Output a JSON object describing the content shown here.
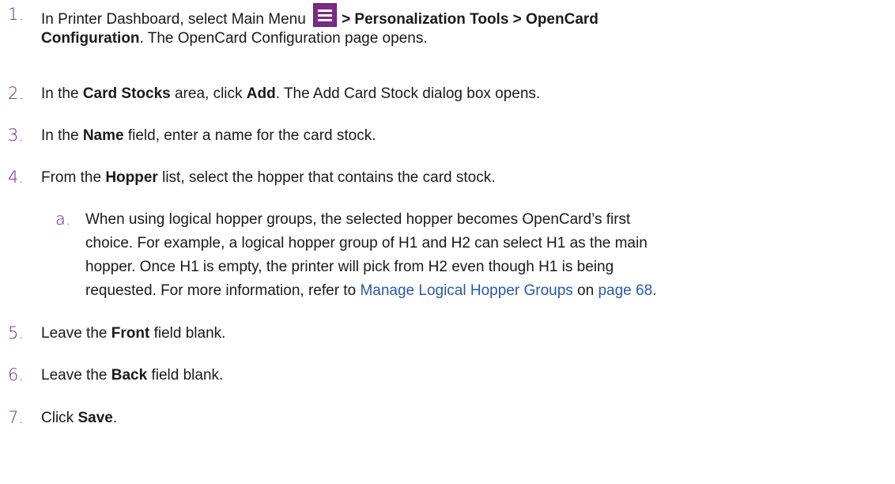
{
  "steps": [
    {
      "number": "1.",
      "line1_pre": "In Printer Dashboard, select Main Menu ",
      "line1_bold": "> Personalization Tools > OpenCard",
      "line2_bold": "Configuration",
      "line2_rest": ". The OpenCard Configuration page opens."
    },
    {
      "number": "2.",
      "pre": "In the ",
      "bold1": "Card Stocks",
      "mid": " area, click ",
      "bold2": "Add",
      "post": ". The Add Card Stock dialog box opens."
    },
    {
      "number": "3.",
      "pre": "In the ",
      "bold": "Name",
      "post": " field, enter a name for the card stock."
    },
    {
      "number": "4.",
      "pre": "From the ",
      "bold": "Hopper",
      "post": " list, select the hopper that contains the card stock.",
      "substep": {
        "number": "a.",
        "line1": "When using logical hopper groups, the selected hopper becomes OpenCard’s first",
        "line2": "choice. For example, a logical hopper group of H1 and H2 can select H1 as the main",
        "line3": "hopper. Once H1 is empty, the printer will pick from H2 even though H1 is being",
        "line4_pre": "requested. For more information, refer to ",
        "link_text": "Manage Logical Hopper Groups",
        "line4_mid": " on ",
        "page_link": "page 68",
        "line4_post": "."
      }
    },
    {
      "number": "5.",
      "pre": "Leave the ",
      "bold": "Front",
      "post": " field blank."
    },
    {
      "number": "6.",
      "pre": "Leave the ",
      "bold": "Back",
      "post": " field blank."
    },
    {
      "number": "7.",
      "pre": "Click ",
      "bold": "Save",
      "post": "."
    }
  ],
  "icons": {
    "main_menu": "hamburger-menu-icon"
  },
  "colors": {
    "number": "#6b2a7d",
    "menu_icon_bg": "#7b2b86",
    "link": "#2a5aa8",
    "text": "#1a1a1a"
  }
}
